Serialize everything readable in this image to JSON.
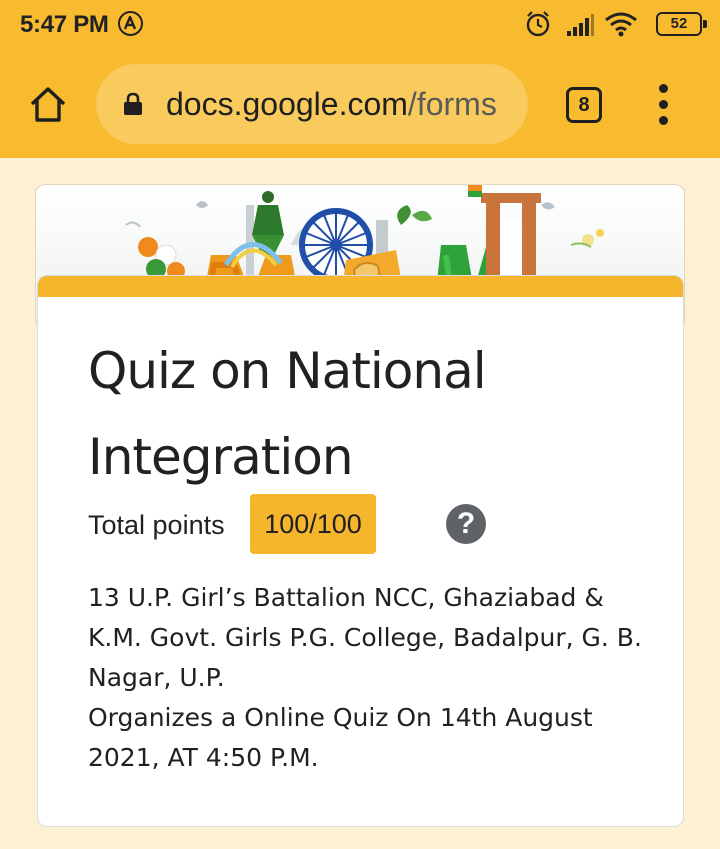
{
  "status_bar": {
    "time": "5:47 PM",
    "battery": "52",
    "icons": [
      "auto-a-icon",
      "alarm-icon",
      "signal-icon",
      "wifi-icon",
      "battery-icon"
    ]
  },
  "browser": {
    "url_domain": "docs.google.com",
    "url_path": "/forms",
    "tab_count": "8",
    "icons": [
      "home-icon",
      "lock-icon",
      "more-vert-icon"
    ]
  },
  "colors": {
    "toolbar": "#f8bb2f",
    "accent": "#f5b52c",
    "page_background": "#fdf0d3"
  },
  "form": {
    "title": "Quiz on National Integration",
    "points_label": "Total points",
    "points_value": "100/100",
    "help_symbol": "?",
    "description": [
      "13 U.P. Girl’s Battalion NCC, Ghaziabad & K.M. Govt. Girls P.G. College, Badalpur, G. B. Nagar, U.P.",
      "Organizes a Online Quiz On 14th August 2021, AT 4:50 P.M."
    ]
  }
}
